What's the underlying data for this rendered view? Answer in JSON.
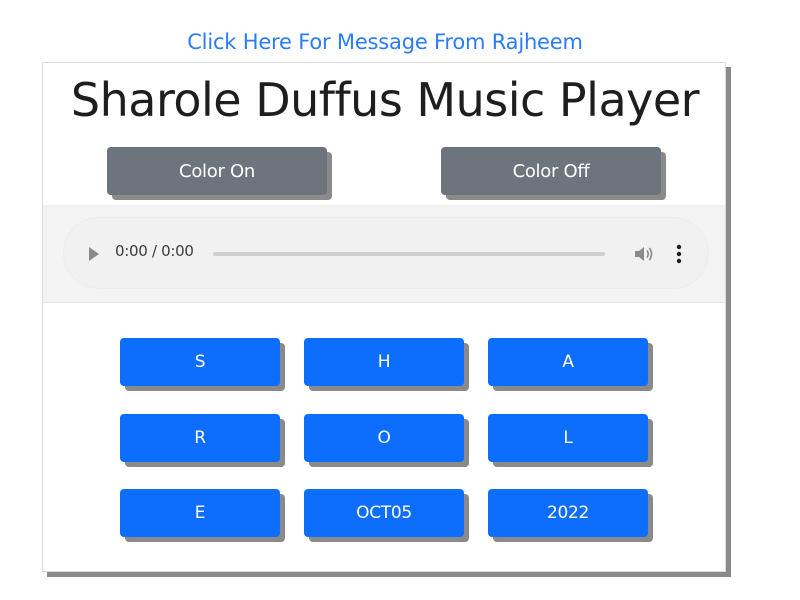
{
  "header": {
    "message_link": "Click Here For Message From Rajheem"
  },
  "card": {
    "title": "Sharole Duffus Music Player",
    "color_on_label": "Color On",
    "color_off_label": "Color Off"
  },
  "audio": {
    "time_display": "0:00 / 0:00",
    "progress": 0,
    "icons": [
      "play-icon",
      "volume-icon",
      "more-options-icon"
    ]
  },
  "letter_buttons": {
    "row1": [
      "S",
      "H",
      "A"
    ],
    "row2": [
      "R",
      "O",
      "L"
    ],
    "row3": [
      "E",
      "OCT05",
      "2022"
    ]
  },
  "colors": {
    "link": "#2a7cf7",
    "gray_button": "#6c757d",
    "blue_button": "#0d6efd",
    "shadow": "#8a8a8a"
  }
}
